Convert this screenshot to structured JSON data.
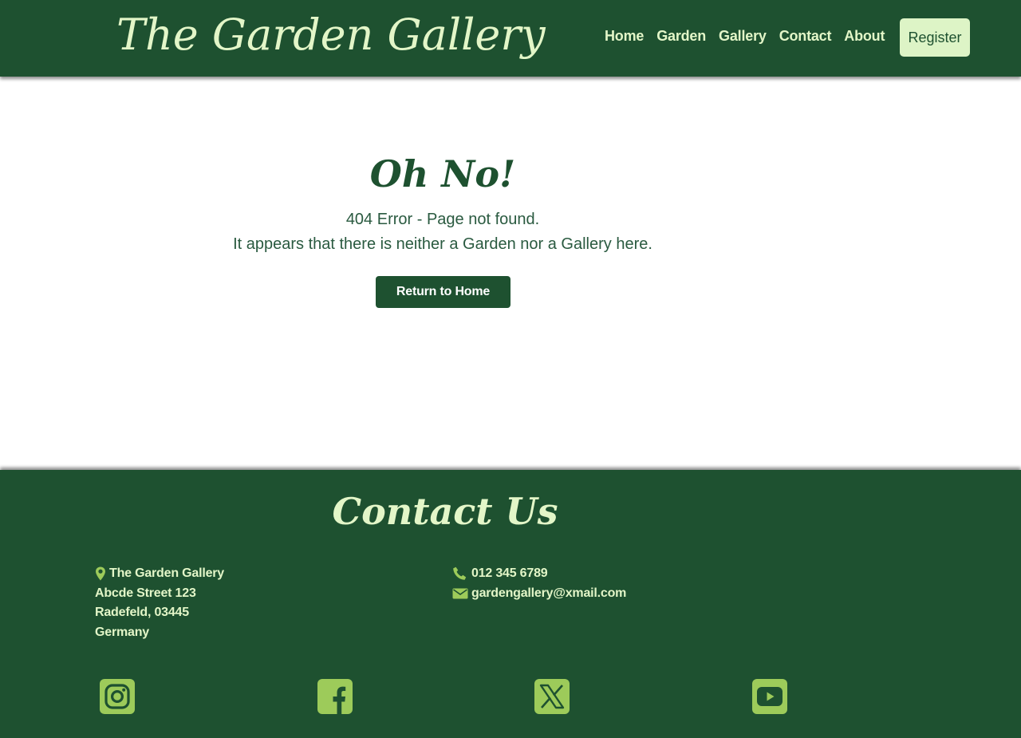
{
  "header": {
    "logo": "The Garden Gallery",
    "nav": [
      "Home",
      "Garden",
      "Gallery",
      "Contact",
      "About"
    ],
    "register_label": "Register"
  },
  "main": {
    "heading": "Oh No!",
    "error_line_1": "404 Error - Page not found.",
    "error_line_2": "It appears that there is neither a Garden nor a Gallery here.",
    "button_label": "Return to Home"
  },
  "footer": {
    "title": "Contact Us",
    "address": [
      "The Garden Gallery",
      "Abcde Street 123",
      "Radefeld, 03445",
      "Germany"
    ],
    "phone": "012 345 6789",
    "email": "gardengallery@xmail.com",
    "social_icons": [
      "instagram-icon",
      "facebook-icon",
      "x-twitter-icon",
      "youtube-icon"
    ]
  },
  "colors": {
    "brand_green": "#1e5130",
    "light_text": "#e3f6c8",
    "icon_green": "#9dcb5a",
    "register_bg": "#ddf4c6"
  }
}
